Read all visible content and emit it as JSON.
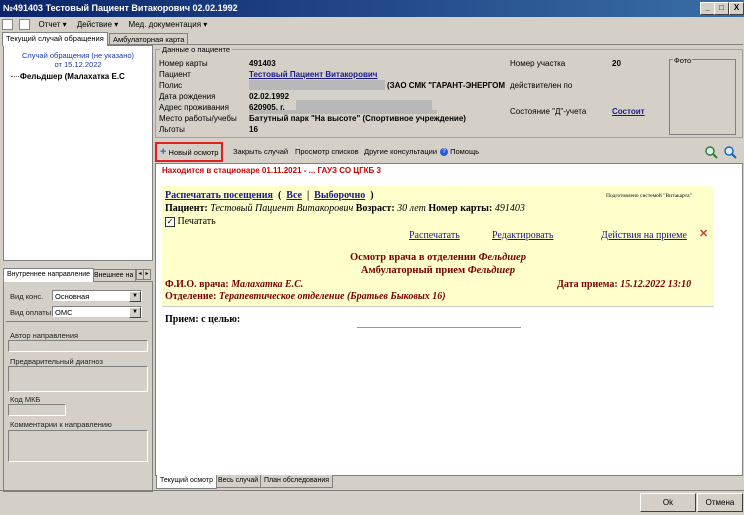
{
  "window": {
    "title": "№491403 Тестовый Пациент Витакорович 02.02.1992",
    "minimize": "_",
    "maximize": "□",
    "close": "X"
  },
  "menu": {
    "report": "Отчет",
    "action": "Действие",
    "med_docs": "Мед. документация"
  },
  "top_tabs": [
    "Текущий случай обращения",
    "Амбулаторная карта"
  ],
  "left_panel": {
    "case_line1": "Случай обращения (не указано)",
    "case_line2": "от 15.12.2022",
    "tree_item": "Фельдшер (Малахатка Е.С"
  },
  "left_bottom": {
    "tabs": [
      "Внутреннее направление",
      "Внешнее на"
    ],
    "vid_kons_label": "Вид конс.",
    "vid_kons_value": "Основная",
    "vid_oplaty_label": "Вид оплаты",
    "vid_oplaty_value": "ОМС",
    "author_label": "Автор направления",
    "prelim_label": "Предварительный диагноз",
    "mkb_label": "Код МКБ",
    "comment_label": "Комментарии к направлению"
  },
  "patient": {
    "group_label": "Данные о пациенте",
    "card_label": "Номер карты",
    "card_value": "491403",
    "patient_label": "Пациент",
    "patient_value": "Тестовый Пациент Витакорович",
    "policy_label": "Полис",
    "policy_value": "(ЗАО СМК \"ГАРАНТ-ЭНЕРГОМЕД\",г.Екатер",
    "policy_valid": "действителен по",
    "birth_label": "Дата рождения",
    "birth_value": "02.02.1992",
    "address_label": "Адрес проживания",
    "address_value": "620905, г.",
    "work_label": "Место работы/учебы",
    "work_value": "Батутный парк \"На высоте\" (Спортивное учреждение)",
    "benefits_label": "Льготы",
    "benefits_value": "16",
    "area_label": "Номер участка",
    "area_value": "20",
    "d_label": "Состояние \"Д\"-учета",
    "d_value": "Состоит",
    "photo_label": "Фото"
  },
  "toolbar": {
    "new_exam": "Новый осмотр",
    "close_case": "Закрыть случай",
    "view_lists": "Просмотр списков",
    "other_consult": "Другие консультации",
    "help": "Помощь"
  },
  "content": {
    "hospital_notice": "Находится в стационаре 01.11.2021 - ... ГАУЗ СО ЦГКБ 3",
    "print_visits": "Распечатать посещения",
    "paren_open": "(",
    "all": "Все",
    "sep": "|",
    "selective": "Выборочно",
    "paren_close": ")",
    "prepared_by": "Подготовлено системой \"Витакарта\"",
    "patient_label": "Пациент:",
    "patient_name": "Тестовый Пациент Витакорович",
    "age_label": "Возраст:",
    "age_value": "30 лет",
    "card_label": "Номер карты:",
    "card_value": "491403",
    "print_checkbox": "Печатать",
    "link_print": "Распечатать",
    "link_edit": "Редактировать",
    "link_actions": "Действия на приеме",
    "delete_glyph": "✕",
    "exam_title": "Осмотр врача в отделении",
    "exam_title_dept": "Фельдшер",
    "amb_title": "Амбулаторный прием",
    "amb_title_dept": "Фельдшер",
    "doctor_label": "Ф.И.О. врача:",
    "doctor_value": "Малахатка Е.С.",
    "date_label": "Дата приема:",
    "date_value": "15.12.2022 13:10",
    "dept_label": "Отделение:",
    "dept_value": "Терапевтическое отделение (Братьев Быковых 16)",
    "reception_label": "Прием: с целью:"
  },
  "bottom_tabs": [
    "Текущий осмотр",
    "Весь случай",
    "План обследования"
  ],
  "buttons": {
    "ok": "Ok",
    "cancel": "Отмена"
  },
  "colors": {
    "title_bar": "#0a246a",
    "highlight_box": "#e02020",
    "notice_red": "#cc0000",
    "doc_yellow": "#ffffcc",
    "maroon": "#7a0000"
  }
}
